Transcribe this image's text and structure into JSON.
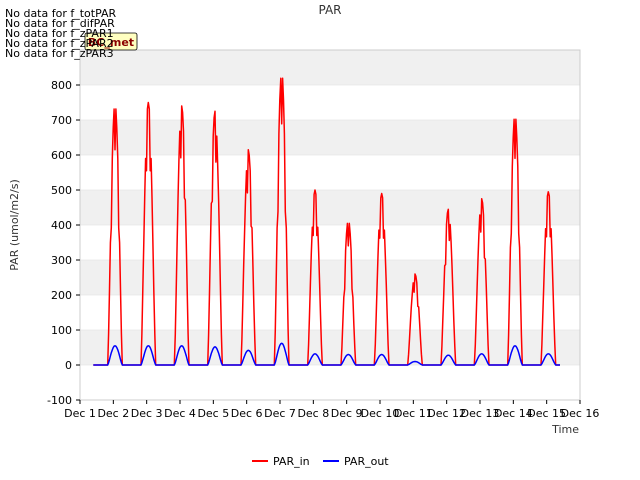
{
  "title": "PAR",
  "no_data_notes": [
    "No data for f_totPAR",
    "No data for f_difPAR",
    "No data for f_zPAR1",
    "No data for f_zPAR2",
    "No data for f_zPAR3"
  ],
  "badge": "BC_met",
  "colors": {
    "par_in": "#ff0000",
    "par_out": "#0000ff",
    "band": "#f0f0f0",
    "grid": "#dddddd"
  },
  "chart_data": {
    "type": "line",
    "title": "PAR",
    "xlabel": "Time",
    "ylabel": "PAR (umol/m2/s)",
    "xlim": [
      1,
      16
    ],
    "ylim": [
      -100,
      900
    ],
    "x_ticks": [
      "Dec 1",
      "Dec 2",
      "Dec 3",
      "Dec 4",
      "Dec 5",
      "Dec 6",
      "Dec 7",
      "Dec 8",
      "Dec 9",
      "Dec 10",
      "Dec 11",
      "Dec 12",
      "Dec 13",
      "Dec 14",
      "Dec 15",
      "Dec 16"
    ],
    "y_ticks": [
      -100,
      0,
      100,
      200,
      300,
      400,
      500,
      600,
      700,
      800
    ],
    "legend_position": "bottom-center",
    "grid": true,
    "series": [
      {
        "name": "PAR_in",
        "daily_peaks": [
          {
            "day": "Dec 2",
            "peak": 750
          },
          {
            "day": "Dec 3",
            "peak": 750
          },
          {
            "day": "Dec 4",
            "peak": 740
          },
          {
            "day": "Dec 5",
            "peak": 725
          },
          {
            "day": "Dec 6",
            "peak": 615
          },
          {
            "day": "Dec 7",
            "peak": 840
          },
          {
            "day": "Dec 8",
            "peak": 500
          },
          {
            "day": "Dec 9",
            "peak": 415
          },
          {
            "day": "Dec 10",
            "peak": 490
          },
          {
            "day": "Dec 11",
            "peak": 260
          },
          {
            "day": "Dec 12",
            "peak": 445
          },
          {
            "day": "Dec 13",
            "peak": 475
          },
          {
            "day": "Dec 14",
            "peak": 720
          },
          {
            "day": "Dec 15",
            "peak": 495
          }
        ]
      },
      {
        "name": "PAR_out",
        "daily_peaks": [
          {
            "day": "Dec 2",
            "peak": 55
          },
          {
            "day": "Dec 3",
            "peak": 55
          },
          {
            "day": "Dec 4",
            "peak": 55
          },
          {
            "day": "Dec 5",
            "peak": 52
          },
          {
            "day": "Dec 6",
            "peak": 42
          },
          {
            "day": "Dec 7",
            "peak": 62
          },
          {
            "day": "Dec 8",
            "peak": 32
          },
          {
            "day": "Dec 9",
            "peak": 30
          },
          {
            "day": "Dec 10",
            "peak": 30
          },
          {
            "day": "Dec 11",
            "peak": 10
          },
          {
            "day": "Dec 12",
            "peak": 28
          },
          {
            "day": "Dec 13",
            "peak": 32
          },
          {
            "day": "Dec 14",
            "peak": 55
          },
          {
            "day": "Dec 15",
            "peak": 32
          }
        ]
      }
    ]
  }
}
